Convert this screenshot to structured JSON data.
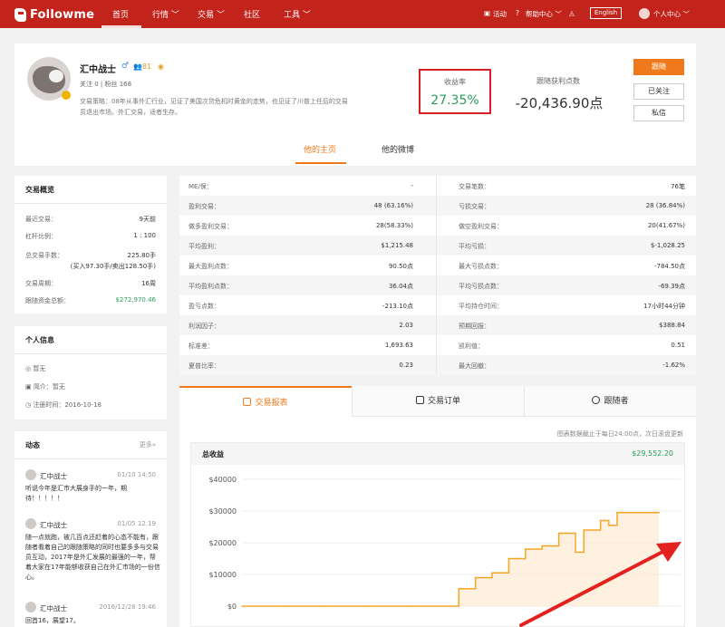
{
  "nav": {
    "brand": "Followme",
    "items": [
      "首页",
      "行情 ﹀",
      "交易 ﹀",
      "社区",
      "工具 ﹀"
    ],
    "right": {
      "activity": "活动",
      "help": "帮助中心 ﹀",
      "english": "English",
      "user": "个人中心 ﹀"
    }
  },
  "profile": {
    "name": "汇中战士",
    "sex_icon": "♂",
    "fans_icon_text": "👥81",
    "weibo_icon": "◉",
    "follow_text": "关注 0  |  粉丝 168",
    "bio": "交易策略：08年从事外汇行业，见证了美国次贷危机时黄金的走势，也见证了川普上任后的交易员退出市场。外汇交易，适者生存。",
    "profit_label": "收益率",
    "profit_value": "27.35%",
    "follow_profit_label": "跟随获利点数",
    "follow_profit_value": "-20,436.90点",
    "buttons": {
      "follow": "跟随",
      "followed": "已关注",
      "message": "私信"
    },
    "tabs": {
      "home": "他的主页",
      "weibo": "他的微博"
    }
  },
  "overview": {
    "title": "交易概览",
    "rows": [
      {
        "label": "最近交易：",
        "value": "9天前"
      },
      {
        "label": "杠杆比例：",
        "value": "1 : 100"
      },
      {
        "label": "总交易手数：",
        "value": "225.80手"
      },
      {
        "label": "",
        "value": "(买入97.30手/卖出128.50手)"
      },
      {
        "label": "交易周期：",
        "value": "16周"
      },
      {
        "label": "跟随资金总额：",
        "value": "$272,970.46"
      }
    ]
  },
  "personal": {
    "title": "个人信息",
    "location": "◎ 暂无",
    "intro": "▣ 简介：暂无",
    "register": "◷ 注册时间：2016-10-18"
  },
  "feed": {
    "title": "动态",
    "more": "更多»",
    "items": [
      {
        "name": "汇中战士",
        "time": "01/10 14:50",
        "text": "听说今年是汇市大展身手的一年，期待！！！！！"
      },
      {
        "name": "汇中战士",
        "time": "01/05 12:19",
        "text": "随一点就跑，被几百点还赶着的心态不能有，跟随者看着自己的跟随策略的同时也要多多与交易员互动，2017年是外汇发展的最强的一年，帮着大家在17年能够收获自己在外汇市场的一份信心。"
      },
      {
        "name": "汇中战士",
        "time": "2016/12/28 19:46",
        "text": "回首16，展望17。"
      }
    ]
  },
  "stats": {
    "rows": [
      [
        "ME/保：",
        "-",
        "交易笔数：",
        "76笔"
      ],
      [
        "盈利交易：",
        "48 (63.16%)",
        "亏损交易：",
        "28 (36.84%)"
      ],
      [
        "做多盈利交易：",
        "28(58.33%)",
        "做空盈利交易：",
        "20(41.67%)"
      ],
      [
        "平均盈利：",
        "$1,215.48",
        "平均亏损：",
        "$-1,028.25"
      ],
      [
        "最大盈利点数：",
        "90.50点",
        "最大亏损点数：",
        "-784.50点"
      ],
      [
        "平均盈利点数：",
        "36.04点",
        "平均亏损点数：",
        "-69.39点"
      ],
      [
        "盈亏点数：",
        "-213.10点",
        "平均持仓时间：",
        "17小时44分钟"
      ],
      [
        "利润因子：",
        "2.03",
        "预期回报：",
        "$388.84"
      ],
      [
        "标准差：",
        "1,693.63",
        "凯利值：",
        "0.51"
      ],
      [
        "夏普比率：",
        "0.23",
        "最大回撤：",
        "-1.62%"
      ]
    ]
  },
  "panel": {
    "tabs": [
      "交易报表",
      "交易订单",
      "跟随者"
    ],
    "note": "图表数据截止于每日24:00点，次日滚盘更新",
    "chart_title": "总收益",
    "chart_total": "$29,552.20"
  },
  "colors": {
    "brand_red": "#c2241b",
    "accent_orange": "#f07a1b",
    "profit_green": "#2b9d5b",
    "highlight_red": "#d81f26"
  },
  "chart_data": {
    "type": "area",
    "title": "总收益",
    "ylabel": "",
    "xlabel": "",
    "yticks": [
      "$40000",
      "$30000",
      "$20000",
      "$10000",
      "$0"
    ],
    "ylim": [
      0,
      40000
    ],
    "x": [
      0,
      10,
      20,
      30,
      40,
      50,
      52,
      54,
      56,
      58,
      60,
      62,
      64,
      66,
      68,
      70,
      72,
      74,
      76,
      78,
      80,
      82,
      84,
      86,
      88,
      90,
      92,
      94,
      96,
      100
    ],
    "values": [
      0,
      0,
      0,
      0,
      0,
      0,
      5500,
      5500,
      9000,
      9000,
      10500,
      10500,
      15000,
      15000,
      18000,
      18000,
      19000,
      19000,
      23000,
      23000,
      17000,
      24000,
      24000,
      27000,
      25500,
      29500,
      29500,
      29500,
      29500,
      29552.2
    ],
    "grid": true
  }
}
